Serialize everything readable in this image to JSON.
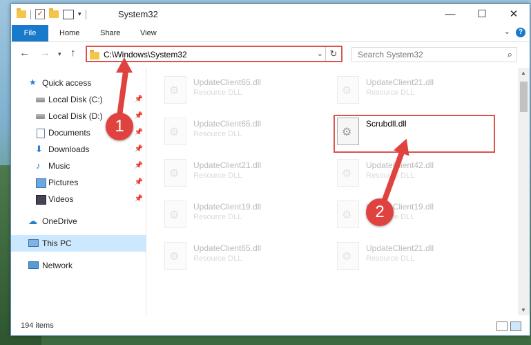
{
  "window": {
    "title": "System32",
    "controls": {
      "minimize": "—",
      "maximize": "☐",
      "close": "✕"
    }
  },
  "quick_access_toolbar": {
    "dropdown": "▾"
  },
  "ribbon": {
    "tabs": [
      {
        "label": "File",
        "active": true
      },
      {
        "label": "Home"
      },
      {
        "label": "Share"
      },
      {
        "label": "View"
      }
    ],
    "help": "?"
  },
  "address_bar": {
    "path": "C:\\Windows\\System32",
    "search_placeholder": "Search System32"
  },
  "sidebar": {
    "items": [
      {
        "label": "Quick access",
        "icon": "star-icon",
        "pinned": false
      },
      {
        "label": "Local Disk (C:)",
        "icon": "drive-icon",
        "pinned": true
      },
      {
        "label": "Local Disk (D:)",
        "icon": "drive-icon",
        "pinned": true
      },
      {
        "label": "Documents",
        "icon": "documents-icon",
        "pinned": true
      },
      {
        "label": "Downloads",
        "icon": "download-icon",
        "pinned": true
      },
      {
        "label": "Music",
        "icon": "music-icon",
        "pinned": true
      },
      {
        "label": "Pictures",
        "icon": "pictures-icon",
        "pinned": true
      },
      {
        "label": "Videos",
        "icon": "videos-icon",
        "pinned": true
      },
      {
        "label": "OneDrive",
        "icon": "onedrive-icon"
      },
      {
        "label": "This PC",
        "icon": "pc-icon",
        "selected": true
      },
      {
        "label": "Network",
        "icon": "network-icon"
      }
    ]
  },
  "files": [
    {
      "name": "UpdateClient65.dll",
      "type": "Resource DLL",
      "faded": true
    },
    {
      "name": "UpdateClient21.dll",
      "type": "Resource DLL",
      "faded": true
    },
    {
      "name": "UpdateClient65.dll",
      "type": "Resource DLL",
      "faded": true
    },
    {
      "name": "Scrubdll.dll",
      "type": "",
      "faded": false,
      "highlighted": true
    },
    {
      "name": "UpdateClient21.dll",
      "type": "Resource DLL",
      "faded": true
    },
    {
      "name": "UpdateClient42.dll",
      "type": "Resource DLL",
      "faded": true
    },
    {
      "name": "UpdateClient19.dll",
      "type": "Resource DLL",
      "faded": true
    },
    {
      "name": "UpdateClient19.dll",
      "type": "Resource DLL",
      "faded": true
    },
    {
      "name": "UpdateClient65.dll",
      "type": "Resource DLL",
      "faded": true
    },
    {
      "name": "UpdateClient21.dll",
      "type": "Resource DLL",
      "faded": true
    }
  ],
  "status": {
    "item_count": "194 items"
  },
  "annotations": {
    "step1": "1",
    "step2": "2",
    "color": "#e0433f"
  }
}
